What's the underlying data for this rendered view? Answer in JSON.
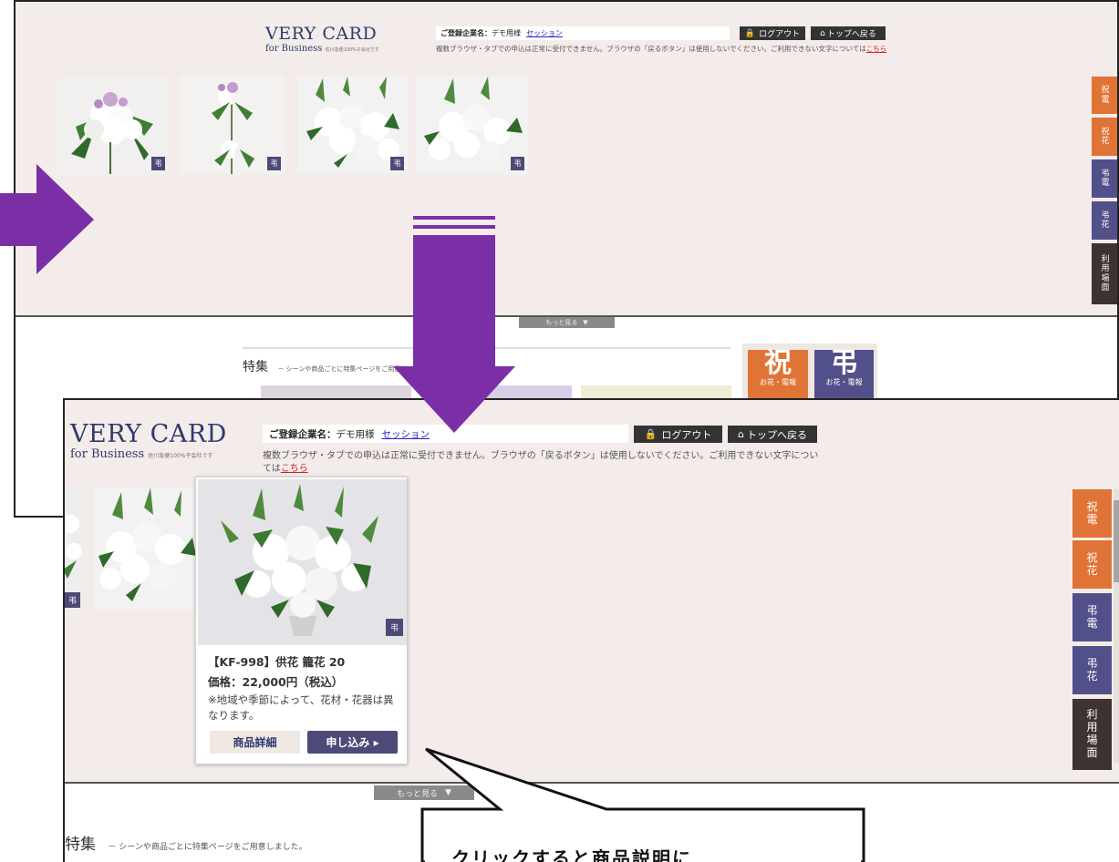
{
  "header": {
    "logo_line1": "VERY CARD",
    "logo_line2": "for Business",
    "logo_small": "佐川急便100%子会社です",
    "company_label": "ご登録企業名：",
    "company_name": "デモ用様",
    "session_link": "セッション",
    "logout_label": "ログアウト",
    "top_label": "トップへ戻る",
    "notice_text": "複数ブラウザ・タブでの申込は正常に受付できません。ブラウザの「戻るボタン」は使用しないでください。ご利用できない文字については",
    "notice_link": "こちら"
  },
  "thumbnails": {
    "tag_label": "弔"
  },
  "side_tabs": [
    {
      "label": [
        "祝",
        "電"
      ],
      "color": "#e07436"
    },
    {
      "label": [
        "祝",
        "花"
      ],
      "color": "#e07436"
    },
    {
      "label": [
        "弔",
        "電"
      ],
      "color": "#52508a"
    },
    {
      "label": [
        "弔",
        "花"
      ],
      "color": "#52508a"
    },
    {
      "label": [
        "利",
        "用",
        "場",
        "面"
      ],
      "color": "#3d3330"
    }
  ],
  "more_button": "もっと見る",
  "feature": {
    "title": "特集",
    "subtitle": "－ シーンや商品ごとに特集ページをご用意しました。"
  },
  "big_icons": [
    {
      "kanji": "祝",
      "sub": "お花・電報",
      "color": "#e07436"
    },
    {
      "kanji": "弔",
      "sub": "お花・電報",
      "color": "#52508a"
    }
  ],
  "product_popup": {
    "name": "【KF-998】供花 籠花 20",
    "price": "価格：22,000円（税込）",
    "note": "※地域や季節によって、花材・花器は異なります。",
    "tag": "弔",
    "detail_button": "商品詳細",
    "apply_button": "申し込み ▸"
  },
  "callout": {
    "text": "クリックすると商品説明に"
  },
  "colors": {
    "arrow": "#7b2fa6",
    "page_bg": "#f4ecea",
    "brand_navy": "#2c3a6e",
    "accent_orange": "#e07436",
    "accent_purple": "#52508a"
  }
}
